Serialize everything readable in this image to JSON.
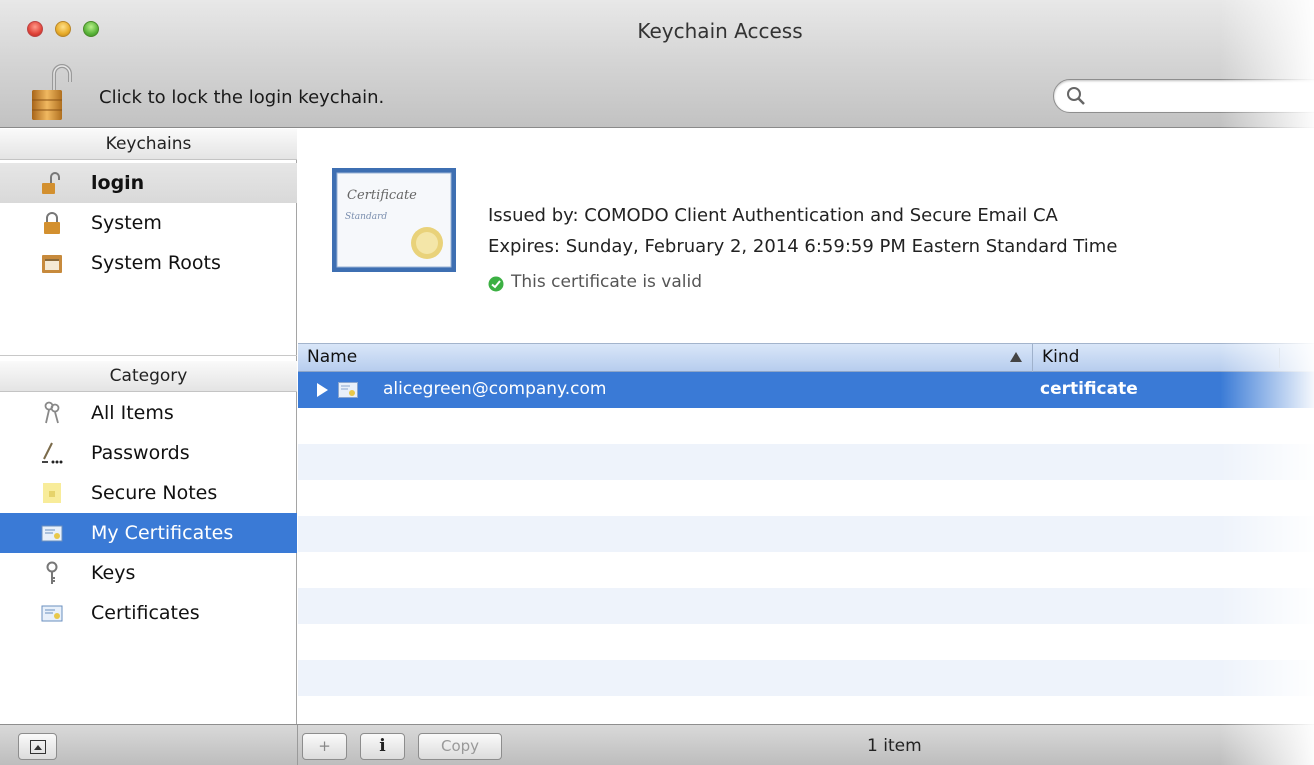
{
  "window": {
    "title": "Keychain Access"
  },
  "toolbar": {
    "lock_label": "Click to lock the login keychain.",
    "search_placeholder": "",
    "search_value": ""
  },
  "sidebar": {
    "keychains_header": "Keychains",
    "keychains": [
      {
        "label": "login",
        "icon": "unlocked-padlock-icon",
        "selected": true
      },
      {
        "label": "System",
        "icon": "padlock-icon",
        "selected": false
      },
      {
        "label": "System Roots",
        "icon": "cabinet-icon",
        "selected": false
      }
    ],
    "category_header": "Category",
    "categories": [
      {
        "label": "All Items",
        "icon": "keys-icon",
        "selected": false
      },
      {
        "label": "Passwords",
        "icon": "pen-ellipsis-icon",
        "selected": false
      },
      {
        "label": "Secure Notes",
        "icon": "note-icon",
        "selected": false
      },
      {
        "label": "My Certificates",
        "icon": "certificate-card-icon",
        "selected": true
      },
      {
        "label": "Keys",
        "icon": "key-icon",
        "selected": false
      },
      {
        "label": "Certificates",
        "icon": "certificate-card-icon",
        "selected": false
      }
    ]
  },
  "detail": {
    "issued_by": "Issued by: COMODO Client Authentication and Secure Email CA",
    "expires": "Expires: Sunday, February 2, 2014 6:59:59 PM Eastern Standard Time",
    "validity": "This certificate is valid",
    "cert_art_text": [
      "Certificate",
      "Standard"
    ]
  },
  "table": {
    "columns": [
      "Name",
      "Kind"
    ],
    "sort_indicator": "ascending",
    "rows": [
      {
        "name": "alicegreen@company.com",
        "kind": "certificate",
        "selected": true
      }
    ]
  },
  "bottombar": {
    "add_label": "+",
    "info_label": "i",
    "copy_label": "Copy",
    "item_count": "1 item"
  },
  "colors": {
    "selection_blue": "#3a7ad6",
    "header_blue": "#c7d9f2",
    "valid_green": "#3cb043"
  }
}
